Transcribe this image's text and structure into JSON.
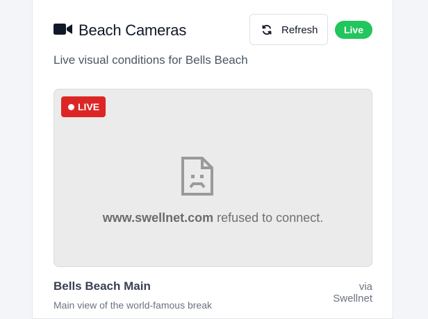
{
  "header": {
    "title": "Beach Cameras",
    "refresh_label": "Refresh",
    "status_pill": "Live",
    "icon": "video-camera-icon"
  },
  "subtitle": "Live visual conditions for Bells Beach",
  "camera": {
    "badge_label": "LIVE",
    "error": {
      "host": "www.swellnet.com",
      "message": " refused to connect.",
      "icon": "sad-document-icon"
    },
    "name": "Bells Beach Main",
    "source": "via Swellnet",
    "description": "Main view of the world-famous break"
  },
  "colors": {
    "live_green": "#22c55e",
    "live_red": "#dc2626",
    "frame_bg": "#ebebeb"
  }
}
